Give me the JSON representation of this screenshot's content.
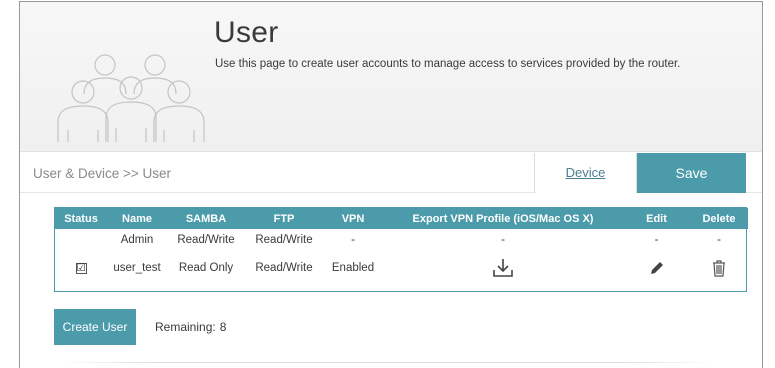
{
  "header": {
    "title": "User",
    "description": "Use this page to create user accounts to manage access to services provided by the router.",
    "icon": "users-group-icon"
  },
  "nav": {
    "breadcrumb": "User & Device >> User",
    "device_link": "Device",
    "save_label": "Save"
  },
  "table": {
    "headers": [
      "Status",
      "Name",
      "SAMBA",
      "FTP",
      "VPN",
      "Export VPN Profile (iOS/Mac OS X)",
      "Edit",
      "Delete"
    ],
    "rows": [
      {
        "status": "",
        "name": "Admin",
        "samba": "Read/Write",
        "ftp": "Read/Write",
        "vpn": "-",
        "export": "-",
        "edit": "-",
        "delete": "-"
      },
      {
        "status": "☑",
        "name": "user_test",
        "samba": "Read Only",
        "ftp": "Read/Write",
        "vpn": "Enabled",
        "export_icon": "download-icon",
        "edit_icon": "pencil-icon",
        "delete_icon": "trash-icon"
      }
    ]
  },
  "footer": {
    "create_label": "Create User",
    "remaining_label": "Remaining:",
    "remaining_count": "8"
  },
  "colors": {
    "accent": "#4b9bab",
    "link": "#4a7f91",
    "icon_line": "#c4c4c4"
  }
}
